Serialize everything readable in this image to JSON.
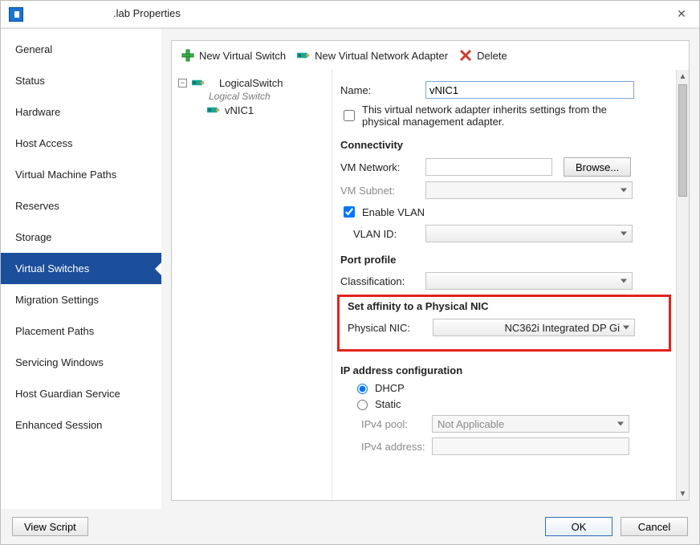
{
  "window": {
    "title": ".lab Properties",
    "close_tooltip": "Close"
  },
  "sidebar": {
    "items": [
      {
        "label": "General"
      },
      {
        "label": "Status"
      },
      {
        "label": "Hardware"
      },
      {
        "label": "Host Access"
      },
      {
        "label": "Virtual Machine Paths"
      },
      {
        "label": "Reserves"
      },
      {
        "label": "Storage"
      },
      {
        "label": "Virtual Switches"
      },
      {
        "label": "Migration Settings"
      },
      {
        "label": "Placement Paths"
      },
      {
        "label": "Servicing Windows"
      },
      {
        "label": "Host Guardian Service"
      },
      {
        "label": "Enhanced Session"
      }
    ],
    "selected_index": 7
  },
  "toolbar": {
    "new_switch": "New Virtual Switch",
    "new_vnic": "New Virtual Network Adapter",
    "delete": "Delete"
  },
  "tree": {
    "switch_name": "LogicalSwitch",
    "switch_subtitle": "Logical Switch",
    "vnic_name": "vNIC1"
  },
  "form": {
    "name_label": "Name:",
    "name_value": "vNIC1",
    "inherit_label": "This virtual network adapter inherits settings from the physical management adapter.",
    "connectivity_heading": "Connectivity",
    "vm_network_label": "VM Network:",
    "browse_label": "Browse...",
    "vm_subnet_label": "VM Subnet:",
    "enable_vlan_label": "Enable VLAN",
    "vlan_id_label": "VLAN ID:",
    "port_profile_heading": "Port profile",
    "classification_label": "Classification:",
    "affinity_heading": "Set affinity to a Physical NIC",
    "physical_nic_label": "Physical NIC:",
    "physical_nic_value": "NC362i Integrated DP Gi",
    "ip_heading": "IP address configuration",
    "dhcp_label": "DHCP",
    "static_label": "Static",
    "ipv4_pool_label": "IPv4 pool:",
    "ipv4_pool_value": "Not Applicable",
    "ipv4_addr_label": "IPv4 address:"
  },
  "footer": {
    "view_script": "View Script",
    "ok": "OK",
    "cancel": "Cancel"
  },
  "icons": {
    "plus": "plus-icon",
    "nic": "network-adapter-icon",
    "delete": "delete-icon"
  }
}
